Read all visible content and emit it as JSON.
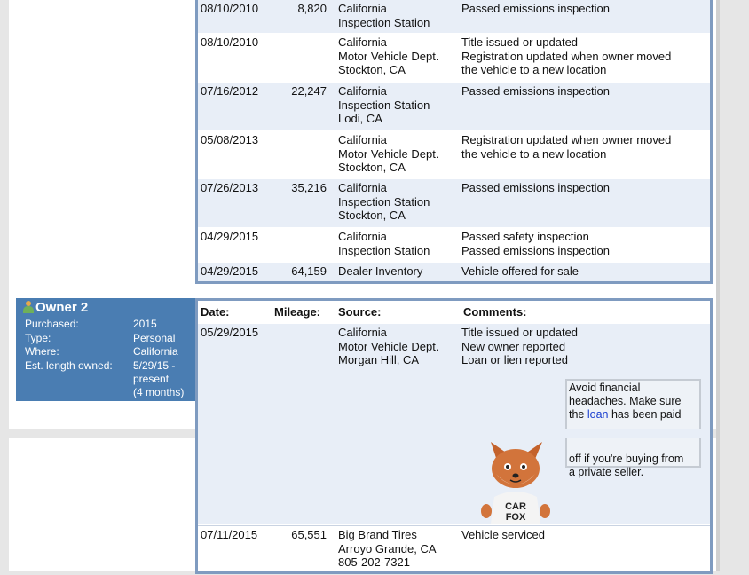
{
  "history_top": [
    {
      "date": "08/10/2010",
      "mileage": "8,820",
      "source": "California\nInspection Station",
      "comments": "Passed emissions inspection"
    },
    {
      "date": "08/10/2010",
      "mileage": "",
      "source": "California\nMotor Vehicle Dept.\nStockton, CA",
      "comments": "Title issued or updated\nRegistration updated when owner moved\nthe vehicle to a new location"
    },
    {
      "date": "07/16/2012",
      "mileage": "22,247",
      "source": "California\nInspection Station\nLodi, CA",
      "comments": "Passed emissions inspection"
    },
    {
      "date": "05/08/2013",
      "mileage": "",
      "source": "California\nMotor Vehicle Dept.\nStockton, CA",
      "comments": "Registration updated when owner moved\nthe vehicle to a new location"
    },
    {
      "date": "07/26/2013",
      "mileage": "35,216",
      "source": "California\nInspection Station\nStockton, CA",
      "comments": "Passed emissions inspection"
    },
    {
      "date": "04/29/2015",
      "mileage": "",
      "source": "California\nInspection Station",
      "comments": "Passed safety inspection\nPassed emissions inspection"
    },
    {
      "date": "04/29/2015",
      "mileage": "64,159",
      "source": "Dealer Inventory",
      "comments": "Vehicle offered for sale"
    }
  ],
  "owner2": {
    "title": "Owner 2",
    "fields": [
      {
        "label": "Purchased:",
        "value": "2015"
      },
      {
        "label": "Type:",
        "value": "Personal"
      },
      {
        "label": "Where:",
        "value": "California"
      },
      {
        "label": "Est. length owned:",
        "value": "5/29/15 -\npresent\n(4 months)"
      }
    ]
  },
  "columns": {
    "date": "Date:",
    "mileage": "Mileage:",
    "source": "Source:",
    "comments": "Comments:"
  },
  "history_owner2": [
    {
      "date": "05/29/2015",
      "mileage": "",
      "source": "California\nMotor Vehicle Dept.\nMorgan Hill, CA",
      "comments": "Title issued or updated\nNew owner reported\nLoan or lien reported"
    }
  ],
  "tip": {
    "part1": "Avoid financial\nheadaches. Make sure\nthe ",
    "link": "loan",
    "part2": " has been paid",
    "part3": "off if you're buying from\na private seller."
  },
  "mascot": {
    "shirt_text_1": "CAR",
    "shirt_text_2": "FOX"
  },
  "history_bottom": [
    {
      "date": "07/11/2015",
      "mileage": "65,551",
      "source": "Big Brand Tires\nArroyo Grande, CA\n805-202-7321",
      "comments": "Vehicle serviced"
    }
  ],
  "colors": {
    "owner_panel": "#4a7db2",
    "table_border": "#7f9bc0",
    "row_alt": "#e8eef7",
    "link": "#1a3fcf"
  }
}
